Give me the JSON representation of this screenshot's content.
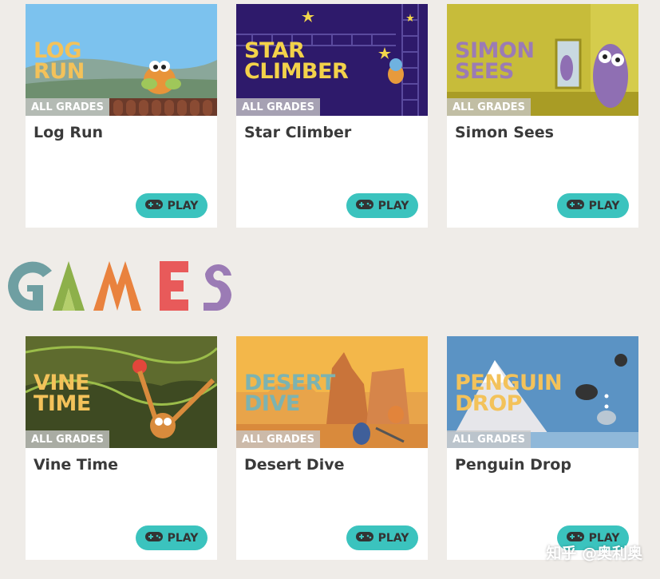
{
  "section_heading": "GAMES",
  "row1": [
    {
      "thumb_title": "LOG\nRUN",
      "badge": "ALL GRADES",
      "title": "Log Run",
      "button": "PLAY"
    },
    {
      "thumb_title": "STAR\nCLIMBER",
      "badge": "ALL GRADES",
      "title": "Star Climber",
      "button": "PLAY"
    },
    {
      "thumb_title": "SIMON\nSEES",
      "badge": "ALL GRADES",
      "title": "Simon Sees",
      "button": "PLAY"
    }
  ],
  "row2": [
    {
      "thumb_title": "VINE\nTIME",
      "badge": "ALL GRADES",
      "title": "Vine Time",
      "button": "PLAY"
    },
    {
      "thumb_title": "DESERT\nDIVE",
      "badge": "ALL GRADES",
      "title": "Desert Dive",
      "button": "PLAY"
    },
    {
      "thumb_title": "PENGUIN\nDROP",
      "badge": "ALL GRADES",
      "title": "Penguin Drop",
      "button": "PLAY"
    }
  ],
  "watermark": "知乎 @奥利奥",
  "colors": {
    "background": "#efece8",
    "play_button": "#3bc3be",
    "games_letters": [
      "#6f9fa2",
      "#8db04a",
      "#e9823e",
      "#e85a5a",
      "#9b7bb5"
    ]
  },
  "icons": {
    "play_button_icon": "gamepad-icon"
  }
}
